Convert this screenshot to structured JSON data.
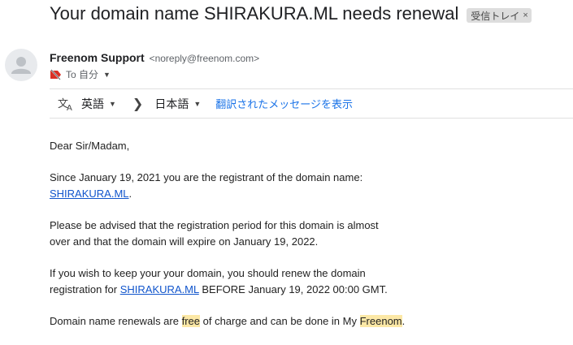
{
  "email": {
    "subject": "Your domain name SHIRAKURA.ML needs renewal",
    "label": "受信トレイ",
    "label_close": "×",
    "sender_name": "Freenom Support",
    "sender_email": "<noreply@freenom.com>",
    "to_text": "To 自分"
  },
  "translate": {
    "source_lang": "英語",
    "target_lang": "日本語",
    "show_translation": "翻訳されたメッセージを表示"
  },
  "body": {
    "greeting": "Dear Sir/Madam,",
    "p1_text": "Since January 19, 2021 you are the registrant of the domain name:",
    "p1_link": "SHIRAKURA.ML",
    "p1_end": ".",
    "p2_line1": "Please be advised that the registration period for this domain is almost",
    "p2_line2": "over and that the domain will expire on January 19, 2022.",
    "p3_line1": "If you wish to keep your your domain, you should renew the domain",
    "p3_line2_start": "registration for",
    "p3_link": "SHIRAKURA.ML",
    "p3_line2_end": "BEFORE January 19, 2022 00:00 GMT.",
    "p4_start": "Domain name renewals are",
    "p4_hl1": "free",
    "p4_mid": "of charge and can be done in My",
    "p4_hl2": "Freenom",
    "p4_end": "."
  },
  "colors": {
    "link": "#1155cc",
    "translate_link": "#1a73e8",
    "highlight": "#fce8a6",
    "important_tag": "#d93025"
  },
  "icons": [
    "person-avatar-icon",
    "important-tag-icon",
    "translate-icon",
    "chevron-right-icon",
    "dropdown-icon"
  ]
}
